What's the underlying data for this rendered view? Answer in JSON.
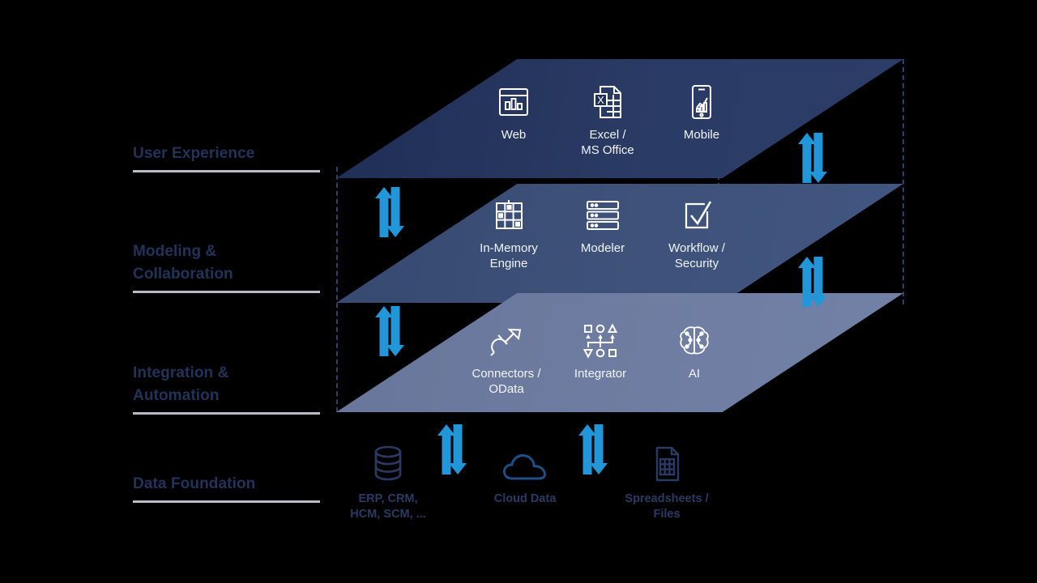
{
  "diagram": {
    "title": "Platform layer architecture",
    "colors": {
      "layer_user_experience": "#2a3b65",
      "layer_modeling": "#3e527b",
      "layer_integration": "#6e7da1",
      "arrow": "#2196d8",
      "label_text": "#223359",
      "rule": "#b9bcc4",
      "dashed_guide": "#2c4170",
      "background": "#000000"
    }
  },
  "categories": [
    {
      "id": "user-experience",
      "label": "User Experience"
    },
    {
      "id": "modeling-collaboration",
      "label": "Modeling &\nCollaboration"
    },
    {
      "id": "integration-automation",
      "label": "Integration &\nAutomation"
    },
    {
      "id": "data-foundation",
      "label": "Data Foundation"
    }
  ],
  "layers": [
    {
      "id": "user-experience",
      "items": [
        {
          "id": "web",
          "label": "Web",
          "icon": "web-browser-chart-icon"
        },
        {
          "id": "excel",
          "label": "Excel /\nMS Office",
          "icon": "excel-document-icon"
        },
        {
          "id": "mobile",
          "label": "Mobile",
          "icon": "mobile-phone-chart-icon"
        }
      ]
    },
    {
      "id": "modeling-collaboration",
      "items": [
        {
          "id": "in-memory-engine",
          "label": "In-Memory\nEngine",
          "icon": "memory-grid-icon"
        },
        {
          "id": "modeler",
          "label": "Modeler",
          "icon": "server-stack-icon"
        },
        {
          "id": "workflow-security",
          "label": "Workflow /\nSecurity",
          "icon": "checkbox-check-icon"
        }
      ]
    },
    {
      "id": "integration-automation",
      "items": [
        {
          "id": "connectors-odata",
          "label": "Connectors /\nOData",
          "icon": "plug-connector-icon"
        },
        {
          "id": "integrator",
          "label": "Integrator",
          "icon": "integration-flow-icon"
        },
        {
          "id": "ai",
          "label": "AI",
          "icon": "brain-circuit-icon"
        }
      ]
    }
  ],
  "data_sources": [
    {
      "id": "erp",
      "label": "ERP, CRM,\nHCM, SCM, ...",
      "icon": "database-icon"
    },
    {
      "id": "cloud-data",
      "label": "Cloud Data",
      "icon": "cloud-icon"
    },
    {
      "id": "spreadsheets",
      "label": "Spreadsheets /\nFiles",
      "icon": "spreadsheet-file-icon"
    }
  ],
  "connectors": [
    {
      "id": "ux-to-modeling-right",
      "icon": "bidirectional-arrow-icon"
    },
    {
      "id": "modeling-to-integration-right",
      "icon": "bidirectional-arrow-icon"
    },
    {
      "id": "ux-to-modeling-left",
      "icon": "bidirectional-arrow-icon"
    },
    {
      "id": "modeling-to-integration-left",
      "icon": "bidirectional-arrow-icon"
    },
    {
      "id": "integration-to-data-1",
      "icon": "bidirectional-arrow-icon"
    },
    {
      "id": "integration-to-data-2",
      "icon": "bidirectional-arrow-icon"
    }
  ]
}
